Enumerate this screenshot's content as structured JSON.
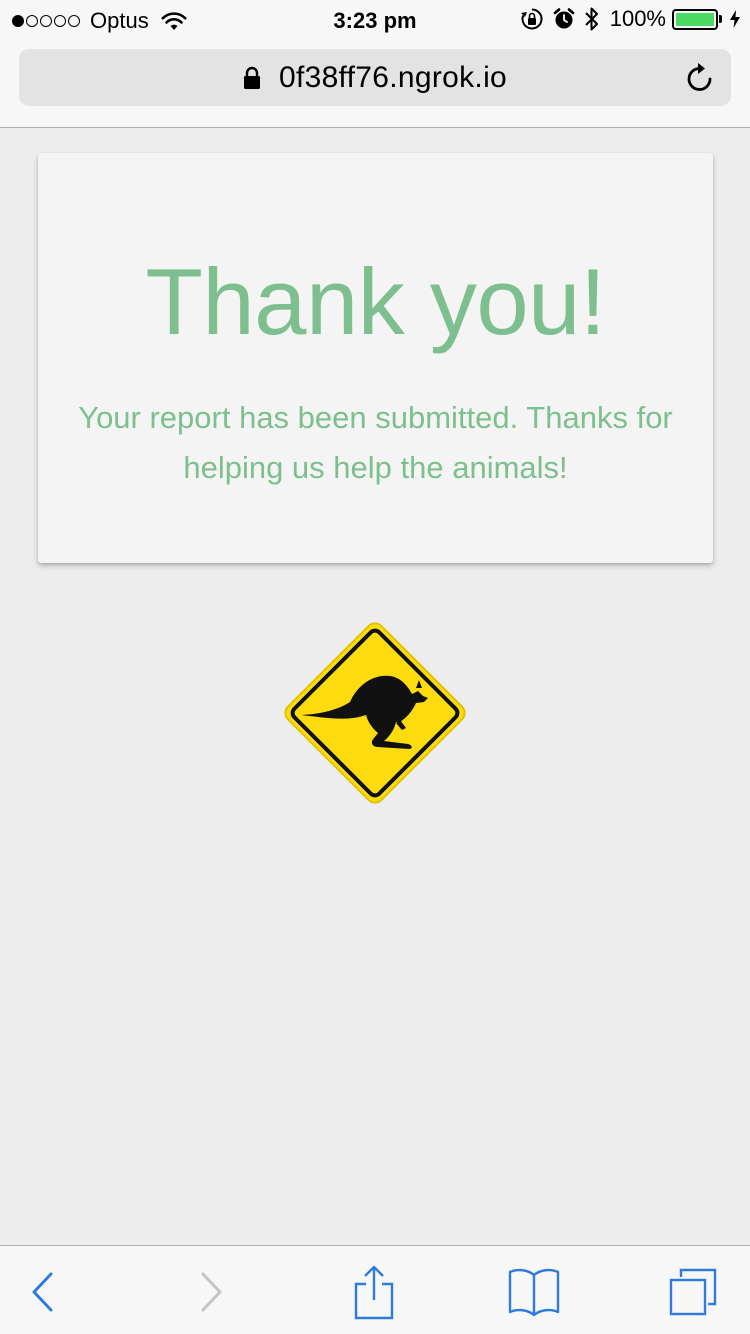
{
  "status_bar": {
    "carrier": "Optus",
    "signal_bars_filled": 1,
    "signal_bars_total": 5,
    "time": "3:23 pm",
    "battery_percent": "100%",
    "battery_level": 1.0,
    "icons": [
      "wifi-icon",
      "orientation-lock-icon",
      "alarm-icon",
      "bluetooth-icon",
      "battery-icon",
      "charging-bolt-icon"
    ]
  },
  "browser": {
    "url": "0f38ff76.ngrok.io",
    "secure_icon": "lock-icon",
    "reload_icon": "reload-icon"
  },
  "card": {
    "title": "Thank you!",
    "message": "Your report has been submitted. Thanks for helping us help the animals!"
  },
  "sign": {
    "icon": "kangaroo-crossing-sign",
    "color": "#fcdc0f"
  },
  "toolbar": {
    "items": [
      "back-icon",
      "forward-icon",
      "share-icon",
      "bookmarks-icon",
      "tabs-icon"
    ],
    "accent_color": "#2f7bd8",
    "disabled_color": "#c4c4c6"
  },
  "colors": {
    "accent_text": "#7dbf8e",
    "background": "#ededed",
    "card": "#f4f4f4"
  }
}
